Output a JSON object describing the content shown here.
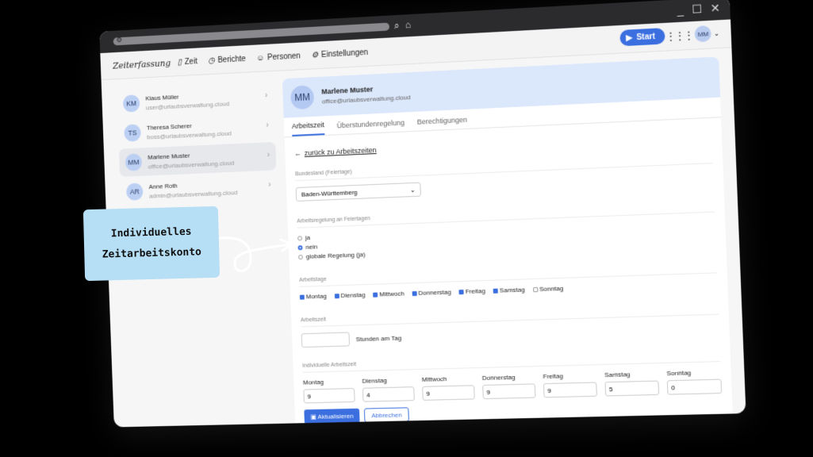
{
  "app": {
    "logo": "Zeiterfassung"
  },
  "nav": [
    {
      "icon": "bookmark-icon",
      "label": "Zeit"
    },
    {
      "icon": "clock-icon",
      "label": "Berichte"
    },
    {
      "icon": "people-icon",
      "label": "Personen"
    },
    {
      "icon": "gear-icon",
      "label": "Einstellungen"
    }
  ],
  "header": {
    "start_label": "Start",
    "avatar_initials": "MM"
  },
  "users": [
    {
      "initials": "KM",
      "name": "Klaus Müller",
      "email": "user@urlaubsverwaltung.cloud"
    },
    {
      "initials": "TS",
      "name": "Theresa Scherer",
      "email": "boss@urlaubsverwaltung.cloud"
    },
    {
      "initials": "MM",
      "name": "Marlene Muster",
      "email": "office@urlaubsverwaltung.cloud",
      "selected": true
    },
    {
      "initials": "AR",
      "name": "Anne Roth",
      "email": "admin@urlaubsverwaltung.cloud"
    }
  ],
  "detail": {
    "initials": "MM",
    "name": "Marlene Muster",
    "email": "office@urlaubsverwaltung.cloud",
    "tabs": [
      "Arbeitszeit",
      "Überstundenregelung",
      "Berechtigungen"
    ],
    "back_label": "zurück zu Arbeitszeiten",
    "bundesland_label": "Bundesland (Feiertage)",
    "bundesland_value": "Baden-Württemberg",
    "holiday_rule_label": "Arbeitsregelung an Feiertagen",
    "holiday_options": [
      "ja",
      "nein",
      "globale Regelung (ja)"
    ],
    "holiday_selected": "nein",
    "workdays_label": "Arbeitstage",
    "workdays": [
      {
        "day": "Montag",
        "checked": true
      },
      {
        "day": "Dienstag",
        "checked": true
      },
      {
        "day": "Mittwoch",
        "checked": true
      },
      {
        "day": "Donnerstag",
        "checked": true
      },
      {
        "day": "Freitag",
        "checked": true
      },
      {
        "day": "Samstag",
        "checked": true
      },
      {
        "day": "Sonntag",
        "checked": false
      }
    ],
    "worktime_label": "Arbeitszeit",
    "hours_suffix": "Stunden am Tag",
    "individual_label": "Individuelle Arbeitszeit",
    "individual": [
      {
        "day": "Montag",
        "value": "9"
      },
      {
        "day": "Dienstag",
        "value": "4"
      },
      {
        "day": "Mittwoch",
        "value": "9"
      },
      {
        "day": "Donnerstag",
        "value": "9"
      },
      {
        "day": "Freitag",
        "value": "9"
      },
      {
        "day": "Samstag",
        "value": "5"
      },
      {
        "day": "Sonntag",
        "value": "0"
      }
    ],
    "update_label": "Aktualisieren",
    "cancel_label": "Abbrechen"
  },
  "callout": {
    "line1": "Individuelles",
    "line2": "Zeitarbeitskonto"
  },
  "colors": {
    "accent": "#3b6fe0",
    "callout_bg": "#b6dff5",
    "header_bg": "#dbe7fb"
  }
}
